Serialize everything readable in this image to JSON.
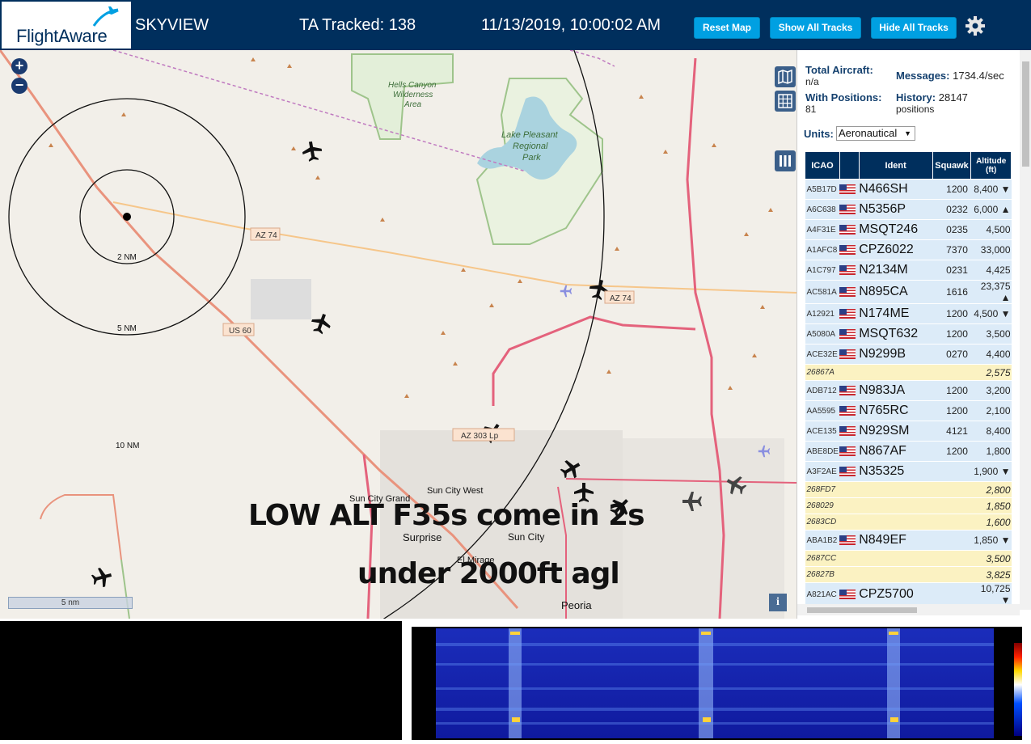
{
  "header": {
    "logo_text": "FlightAware",
    "app_name": "SKYVIEW",
    "tracked": "TA Tracked: 138",
    "datetime": "11/13/2019, 10:00:02 AM",
    "buttons": {
      "reset": "Reset Map",
      "show_all": "Show All Tracks",
      "hide_all": "Hide All Tracks"
    }
  },
  "map": {
    "zoom_in": "+",
    "zoom_out": "−",
    "overlay_line1": "LOW ALT F35s come in 2s",
    "overlay_line2": "under 2000ft agl",
    "scale_label": "5 nm",
    "info": "i",
    "range_rings": [
      "2 NM",
      "5 NM",
      "10 NM"
    ],
    "place_labels": {
      "hells_canyon": "Hells Canyon",
      "wilderness": "Wilderness",
      "area": "Area",
      "lake_pleasant": "Lake Pleasant",
      "regional": "Regional",
      "park": "Park",
      "sun_city_grand": "Sun City Grand",
      "sun_city_west": "Sun City West",
      "surprise": "Surprise",
      "sun_city": "Sun City",
      "el_mirage": "El Mirage",
      "peoria": "Peoria"
    },
    "road_labels": {
      "az74_west": "AZ 74",
      "az74_east": "AZ 74",
      "us60": "US 60",
      "az303": "AZ 303 Lp"
    }
  },
  "sidebar": {
    "total_aircraft_label": "Total Aircraft:",
    "total_aircraft_value": "n/a",
    "with_positions_label": "With Positions:",
    "with_positions_value": "81",
    "messages_label": "Messages:",
    "messages_value": "1734.4/sec",
    "history_label": "History:",
    "history_value": "28147",
    "history_unit": "positions",
    "units_label": "Units:",
    "units_value": "Aeronautical",
    "columns": [
      "ICAO",
      "Ident",
      "Squawk",
      "Altitude (ft)"
    ],
    "rows": [
      {
        "icao": "A5B17D",
        "ident": "N466SH",
        "squawk": "1200",
        "alt": "8,400 ▼",
        "flag": true
      },
      {
        "icao": "A6C638",
        "ident": "N5356P",
        "squawk": "0232",
        "alt": "6,000 ▲",
        "flag": true
      },
      {
        "icao": "A4F31E",
        "ident": "MSQT246",
        "squawk": "0235",
        "alt": "4,500",
        "flag": true
      },
      {
        "icao": "A1AFC8",
        "ident": "CPZ6022",
        "squawk": "7370",
        "alt": "33,000",
        "flag": true
      },
      {
        "icao": "A1C797",
        "ident": "N2134M",
        "squawk": "0231",
        "alt": "4,425",
        "flag": true
      },
      {
        "icao": "AC581A",
        "ident": "N895CA",
        "squawk": "1616",
        "alt": "23,375 ▲",
        "flag": true
      },
      {
        "icao": "A12921",
        "ident": "N174ME",
        "squawk": "1200",
        "alt": "4,500 ▼",
        "flag": true
      },
      {
        "icao": "A5080A",
        "ident": "MSQT632",
        "squawk": "1200",
        "alt": "3,500",
        "flag": true
      },
      {
        "icao": "ACE32E",
        "ident": "N9299B",
        "squawk": "0270",
        "alt": "4,400",
        "flag": true
      },
      {
        "icao": "26867A",
        "ident": "",
        "squawk": "",
        "alt": "2,575",
        "flag": false
      },
      {
        "icao": "ADB712",
        "ident": "N983JA",
        "squawk": "1200",
        "alt": "3,200",
        "flag": true
      },
      {
        "icao": "AA5595",
        "ident": "N765RC",
        "squawk": "1200",
        "alt": "2,100",
        "flag": true
      },
      {
        "icao": "ACE135",
        "ident": "N929SM",
        "squawk": "4121",
        "alt": "8,400",
        "flag": true
      },
      {
        "icao": "ABE8DE",
        "ident": "N867AF",
        "squawk": "1200",
        "alt": "1,800",
        "flag": true
      },
      {
        "icao": "A3F2AE",
        "ident": "N35325",
        "squawk": "",
        "alt": "1,900 ▼",
        "flag": true
      },
      {
        "icao": "268FD7",
        "ident": "",
        "squawk": "",
        "alt": "2,800",
        "flag": false
      },
      {
        "icao": "268029",
        "ident": "",
        "squawk": "",
        "alt": "1,850",
        "flag": false
      },
      {
        "icao": "2683CD",
        "ident": "",
        "squawk": "",
        "alt": "1,600",
        "flag": false
      },
      {
        "icao": "ABA1B2",
        "ident": "N849EF",
        "squawk": "",
        "alt": "1,850 ▼",
        "flag": true
      },
      {
        "icao": "2687CC",
        "ident": "",
        "squawk": "",
        "alt": "3,500",
        "flag": false
      },
      {
        "icao": "26827B",
        "ident": "",
        "squawk": "",
        "alt": "3,825",
        "flag": false
      },
      {
        "icao": "A821AC",
        "ident": "CPZ5700",
        "squawk": "",
        "alt": "10,725 ▼",
        "flag": true
      }
    ]
  },
  "colors": {
    "header_bg": "#002f5d",
    "button_bg": "#00a0e2",
    "row_blue": "#dcebf8",
    "row_yellow": "#fbf2c2"
  }
}
